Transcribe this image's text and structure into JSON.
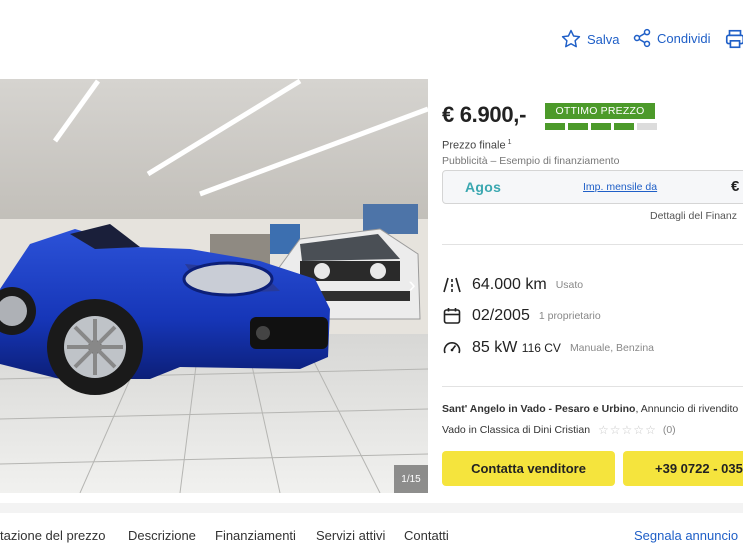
{
  "actions": {
    "save_label": "Salva",
    "share_label": "Condividi"
  },
  "photo": {
    "counter": "1/15"
  },
  "price": {
    "amount": "€ 6.900,-",
    "badge": "OTTIMO PREZZO",
    "rating_level": 4,
    "rating_max": 5,
    "final_label": "Prezzo finale",
    "final_footnote": "1",
    "ad_note": "Pubblicità – Esempio di finanziamento"
  },
  "finance": {
    "brand": "Agos",
    "monthly_link": "Imp. mensile da",
    "currency": "€",
    "details": "Dettagli del Finanz"
  },
  "specs": {
    "mileage": "64.000 km",
    "mileage_note": "Usato",
    "registration": "02/2005",
    "owners": "1 proprietario",
    "power_kw": "85 kW",
    "power_cv": "116 CV",
    "gear_fuel": "Manuale, Benzina"
  },
  "seller": {
    "location": "Sant' Angelo in Vado - Pesaro e Urbino",
    "ad_type": ", Annuncio di rivendito",
    "name": "Vado in Classica di Dini Cristian",
    "stars": "☆☆☆☆☆",
    "review_count": "(0)"
  },
  "buttons": {
    "contact": "Contatta venditore",
    "phone": "+39 0722 - 035"
  },
  "bottom_nav": {
    "items": [
      "tazione del prezzo",
      "Descrizione",
      "Finanziamenti",
      "Servizi attivi",
      "Contatti"
    ],
    "report": "Segnala annuncio"
  },
  "colors": {
    "accent_blue": "#1f5fc7",
    "price_green": "#4c9a2a",
    "cta_yellow": "#f5e43d"
  }
}
